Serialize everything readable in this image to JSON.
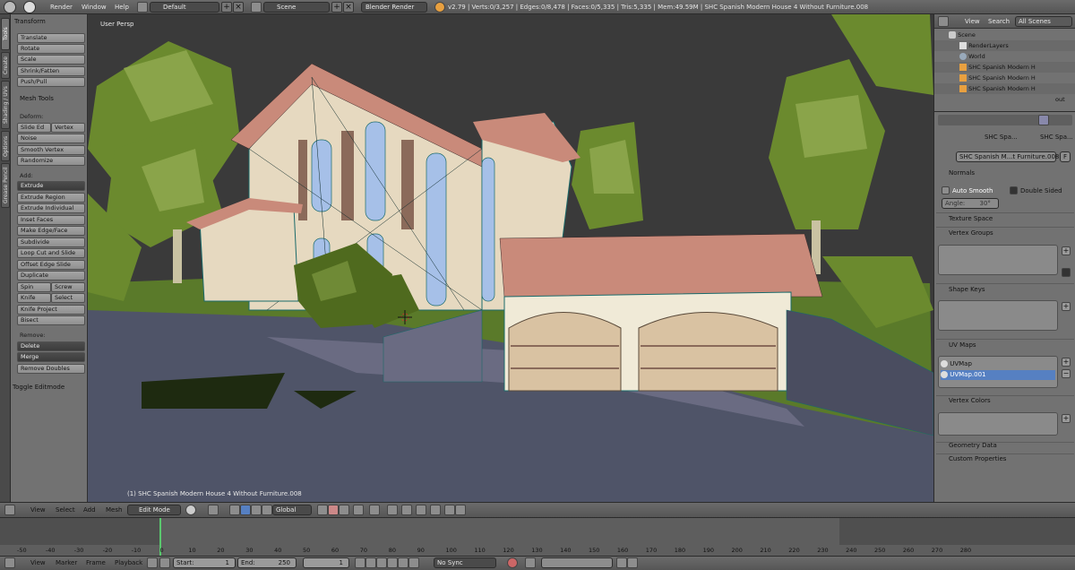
{
  "topbar": {
    "menu_render": "Render",
    "menu_window": "Window",
    "menu_help": "Help",
    "layout": "Default",
    "scene": "Scene",
    "engine": "Blender Render",
    "stats": "v2.79 | Verts:0/3,257 | Edges:0/8,478 | Faces:0/5,335 | Tris:5,335 | Mem:49.59M | SHC Spanish Modern House 4 Without Furniture.008"
  },
  "vtabs": [
    "Tools",
    "Create",
    "Shading / UVs",
    "Options",
    "Grease Pencil"
  ],
  "toolshelf": {
    "transform_header": "Transform",
    "translate": "Translate",
    "rotate": "Rotate",
    "scale": "Scale",
    "shrink_fatten": "Shrink/Fatten",
    "push_pull": "Push/Pull",
    "mesh_tools_header": "Mesh Tools",
    "deform_label": "Deform:",
    "slide_edge": "Slide Ed",
    "vertex": "Vertex",
    "noise": "Noise",
    "smooth_vertex": "Smooth Vertex",
    "randomize": "Randomize",
    "add_label": "Add:",
    "extrude": "Extrude",
    "extrude_region": "Extrude Region",
    "extrude_individual": "Extrude Individual",
    "inset_faces": "Inset Faces",
    "make_edge_face": "Make Edge/Face",
    "subdivide": "Subdivide",
    "loop_cut_slide": "Loop Cut and Slide",
    "offset_edge_slide": "Offset Edge Slide",
    "duplicate": "Duplicate",
    "spin": "Spin",
    "screw": "Screw",
    "knife": "Knife",
    "select": "Select",
    "knife_project": "Knife Project",
    "bisect": "Bisect",
    "remove_label": "Remove:",
    "delete": "Delete",
    "merge": "Merge",
    "remove_doubles": "Remove Doubles",
    "toggle_editmode": "Toggle Editmode"
  },
  "viewport": {
    "persp": "User Persp",
    "object_info": "(1) SHC Spanish Modern House 4 Without Furniture.008"
  },
  "outliner": {
    "view": "View",
    "search": "Search",
    "filter": "All Scenes",
    "rows": [
      "Scene",
      "RenderLayers",
      "World",
      "SHC Spanish Modern H",
      "SHC Spanish Modern H",
      "SHC Spanish Modern H",
      "out"
    ]
  },
  "props": {
    "breadcrumb_a": "SHC Spa...",
    "breadcrumb_b": "SHC Spa...",
    "mesh_name": "SHC Spanish M...t Furniture.008",
    "fake_user": "F",
    "normals": "Normals",
    "auto_smooth": "Auto Smooth",
    "double_sided": "Double Sided",
    "angle_label": "Angle:",
    "angle_value": "30°",
    "texture_space": "Texture Space",
    "vertex_groups": "Vertex Groups",
    "shape_keys": "Shape Keys",
    "uv_maps": "UV Maps",
    "uv_items": [
      "UVMap",
      "UVMap.001"
    ],
    "vertex_colors": "Vertex Colors",
    "geometry_data": "Geometry Data",
    "custom_properties": "Custom Properties"
  },
  "vheader": {
    "view": "View",
    "select": "Select",
    "add": "Add",
    "mesh": "Mesh",
    "mode": "Edit Mode",
    "orientation": "Global"
  },
  "timeline": {
    "ticks": [
      "-50",
      "-40",
      "-30",
      "-20",
      "-10",
      "0",
      "10",
      "20",
      "30",
      "40",
      "50",
      "60",
      "70",
      "80",
      "90",
      "100",
      "110",
      "120",
      "130",
      "140",
      "150",
      "160",
      "170",
      "180",
      "190",
      "200",
      "210",
      "220",
      "230",
      "240",
      "250",
      "260",
      "270",
      "280"
    ],
    "view": "View",
    "marker": "Marker",
    "frame": "Frame",
    "playback": "Playback",
    "start": "Start:",
    "start_value": "1",
    "end": "End:",
    "end_value": "250",
    "current": "1",
    "sync": "No Sync"
  }
}
